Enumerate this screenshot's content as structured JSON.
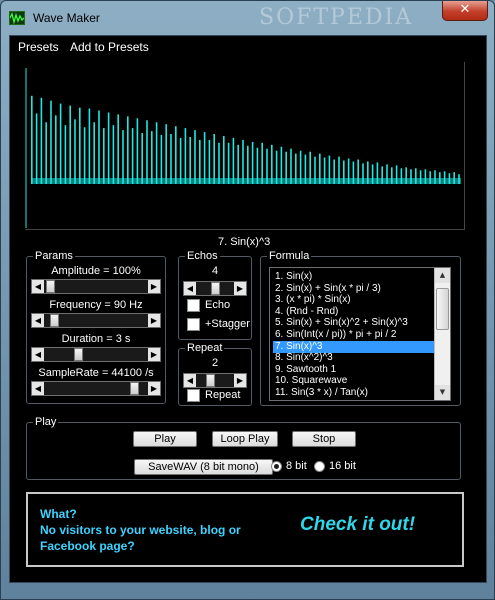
{
  "window": {
    "title": "Wave Maker",
    "watermark": "SOFTPEDIA",
    "close_glyph": "✕"
  },
  "menu": {
    "items": [
      "Presets",
      "Add to Presets"
    ]
  },
  "waveform": {
    "color": "#1ee8e0",
    "bar_levels": [
      0.9,
      0.72,
      0.88,
      0.63,
      0.85,
      0.7,
      0.82,
      0.6,
      0.8,
      0.66,
      0.78,
      0.58,
      0.77,
      0.63,
      0.75,
      0.57,
      0.73,
      0.6,
      0.71,
      0.55,
      0.69,
      0.57,
      0.67,
      0.52,
      0.65,
      0.54,
      0.63,
      0.5,
      0.61,
      0.51,
      0.59,
      0.47,
      0.57,
      0.48,
      0.55,
      0.45,
      0.53,
      0.45,
      0.51,
      0.42,
      0.49,
      0.42,
      0.47,
      0.4,
      0.45,
      0.39,
      0.43,
      0.37,
      0.42,
      0.36,
      0.4,
      0.34,
      0.38,
      0.33,
      0.36,
      0.31,
      0.34,
      0.3,
      0.33,
      0.28,
      0.31,
      0.27,
      0.29,
      0.25,
      0.28,
      0.24,
      0.26,
      0.23,
      0.25,
      0.21,
      0.23,
      0.2,
      0.22,
      0.18,
      0.2,
      0.17,
      0.19,
      0.16,
      0.17,
      0.15,
      0.16,
      0.14,
      0.15,
      0.13,
      0.14,
      0.12,
      0.13,
      0.11,
      0.12,
      0.1
    ]
  },
  "current_formula": "7.  Sin(x)^3",
  "params": {
    "title": "Params",
    "sliders": [
      {
        "label": "Amplitude = 100%",
        "level": 0.02
      },
      {
        "label": "Frequency = 90 Hz",
        "level": 0.06
      },
      {
        "label": "Duration =  3 s",
        "level": 0.32
      },
      {
        "label": "SampleRate =  44100 /s",
        "level": 0.91
      }
    ]
  },
  "echos": {
    "title": "Echos",
    "value": "4",
    "level": 0.52,
    "echo_label": "Echo",
    "stagger_label": "+Stagger"
  },
  "repeat": {
    "title": "Repeat",
    "value": "2",
    "level": 0.33,
    "repeat_label": "Repeat"
  },
  "formula": {
    "title": "Formula",
    "items": [
      "1.  Sin(x)",
      "2.  Sin(x) + Sin(x * pi / 3)",
      "3.  (x * pi) * Sin(x)",
      "4.  (Rnd - Rnd)",
      "5.  Sin(x) + Sin(x)^2 + Sin(x)^3",
      "6.  Sin(Int(x / pi)) * pi + pi / 2",
      "7.  Sin(x)^3",
      "8.  Sin(x^2)^3",
      "9.  Sawtooth 1",
      "10. Squarewave",
      "11. Sin(3 * x) / Tan(x)"
    ],
    "selected_index": 6,
    "scroll_up": "▲",
    "scroll_down": "▼"
  },
  "play": {
    "title": "Play",
    "play_label": "Play",
    "loop_label": "Loop Play",
    "stop_label": "Stop",
    "save_label": "SaveWAV (8 bit mono)",
    "bit8_label": "8 bit",
    "bit16_label": "16 bit"
  },
  "banner": {
    "line1": "What?",
    "line2": "No visitors to your website, blog or",
    "line3": "Facebook page?",
    "cta": "Check it out!"
  }
}
